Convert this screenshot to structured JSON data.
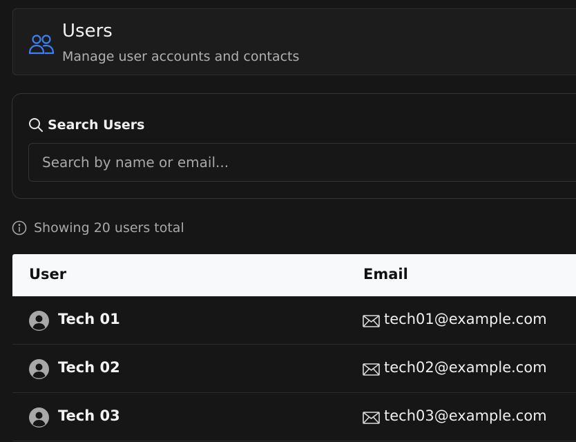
{
  "header": {
    "title": "Users",
    "subtitle": "Manage user accounts and contacts",
    "icon": "users-icon",
    "icon_color": "#3b82f6"
  },
  "search": {
    "heading": "Search Users",
    "placeholder": "Search by name or email...",
    "value": ""
  },
  "info": {
    "text": "Showing 20 users total"
  },
  "table": {
    "columns": [
      "User",
      "Email"
    ],
    "rows": [
      {
        "name": "Tech 01",
        "email": "tech01@example.com"
      },
      {
        "name": "Tech 02",
        "email": "tech02@example.com"
      },
      {
        "name": "Tech 03",
        "email": "tech03@example.com"
      }
    ]
  },
  "colors": {
    "background": "#161616",
    "accent": "#3b82f6",
    "table_header_bg": "#f8f9fb"
  }
}
